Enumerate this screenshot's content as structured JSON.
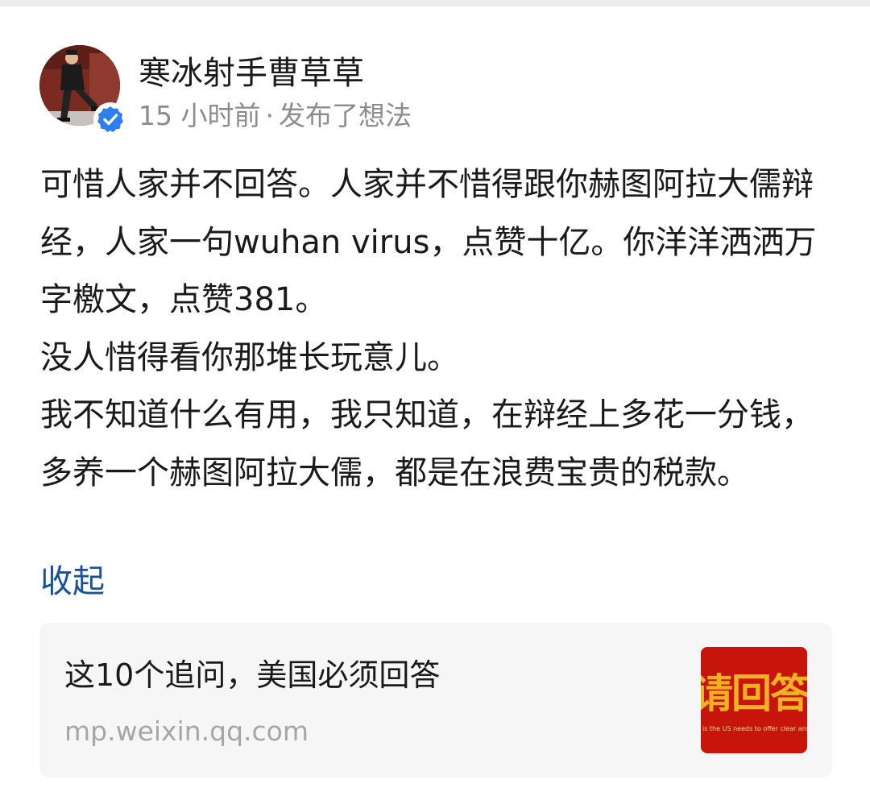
{
  "author": {
    "name": "寒冰射手曹草草",
    "avatar_icon": "user-avatar-photo",
    "verified_icon": "verified-badge-icon",
    "verified_color": "#2d7ff0"
  },
  "meta": {
    "time": "15 小时前",
    "separator": "·",
    "action": "发布了想法"
  },
  "content": {
    "paragraphs": [
      "可惜人家并不回答。人家并不惜得跟你赫图阿拉大儒辩经，人家一句wuhan virus，点赞十亿。你洋洋洒洒万字檄文，点赞381。",
      "没人惜得看你那堆长玩意儿。",
      "我不知道什么有用，我只知道，在辩经上多花一分钱，多养一个赫图阿拉大儒，都是在浪费宝贵的税款。"
    ]
  },
  "collapse_label": "收起",
  "link_card": {
    "title": "这10个追问，美国必须回答",
    "domain": "mp.weixin.qq.com",
    "thumbnail": {
      "headline": "请回答",
      "subline": "is the US needs to offer clear answers",
      "background_color": "#c8150c",
      "text_color": "#f0b122"
    }
  },
  "colors": {
    "link_blue": "#175199",
    "meta_gray": "#8c8c8c",
    "card_bg": "#f6f6f6"
  }
}
